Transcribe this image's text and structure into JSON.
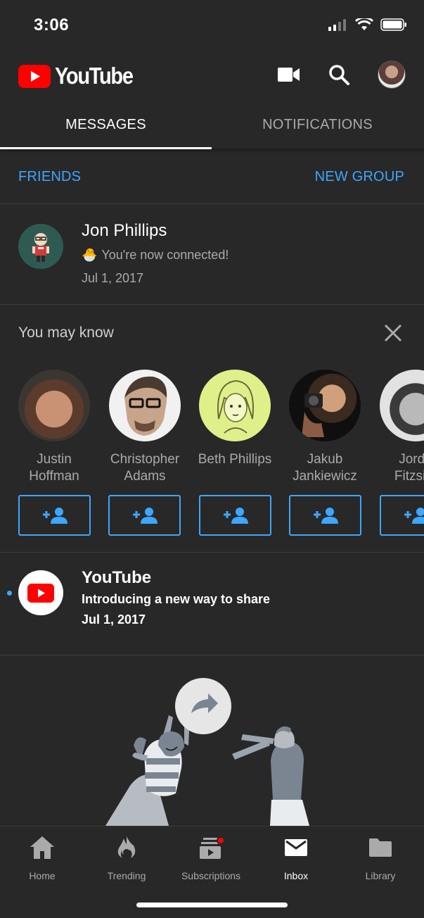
{
  "status": {
    "time": "3:06"
  },
  "app": {
    "logo_text": "YouTube"
  },
  "tabs": [
    {
      "label": "MESSAGES"
    },
    {
      "label": "NOTIFICATIONS"
    }
  ],
  "links": {
    "friends": "FRIENDS",
    "new_group": "NEW GROUP"
  },
  "messages": [
    {
      "name": "Jon Phillips",
      "text": "You're now connected!",
      "date": "Jul 1, 2017",
      "emoji": "🐣"
    },
    {
      "name": "YouTube",
      "text": "Introducing a new way to share",
      "date": "Jul 1, 2017",
      "unread": true
    }
  ],
  "you_may_know": {
    "title": "You may know",
    "people": [
      {
        "name": "Justin\nHoffman"
      },
      {
        "name": "Christopher\nAdams"
      },
      {
        "name": "Beth Phillips"
      },
      {
        "name": "Jakub\nJankiewicz"
      },
      {
        "name": "Jorda\nFitzsim"
      }
    ]
  },
  "nav": [
    {
      "label": "Home",
      "icon": "home-icon"
    },
    {
      "label": "Trending",
      "icon": "trending-icon"
    },
    {
      "label": "Subscriptions",
      "icon": "subscriptions-icon"
    },
    {
      "label": "Inbox",
      "icon": "inbox-icon"
    },
    {
      "label": "Library",
      "icon": "library-icon"
    }
  ],
  "colors": {
    "background": "#282828",
    "accent": "#3ea6ff",
    "brand_red": "#ff0000"
  }
}
